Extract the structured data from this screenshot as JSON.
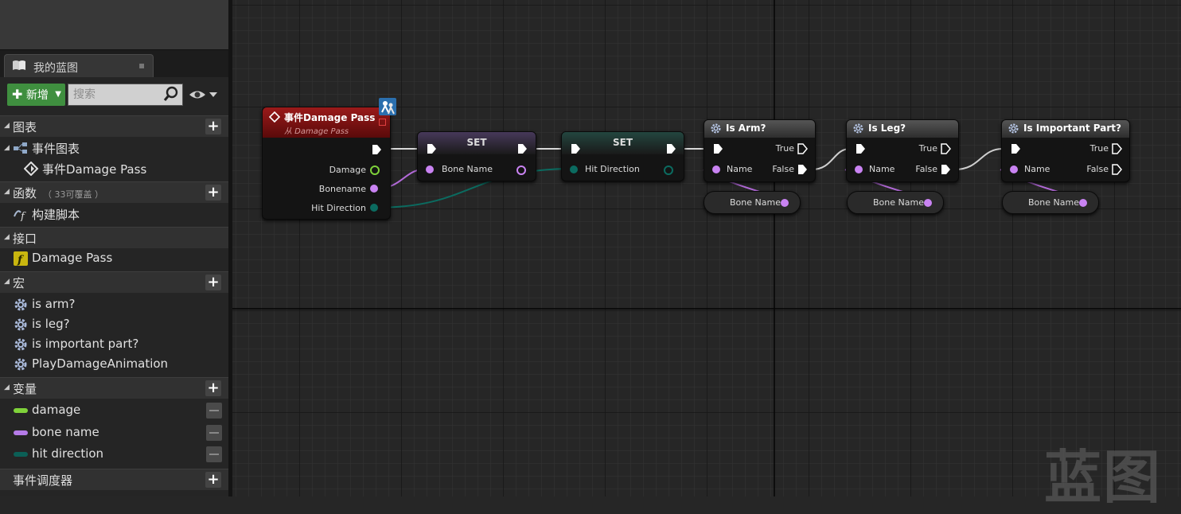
{
  "sidebar": {
    "tab": {
      "label": "我的蓝图"
    },
    "toolbar": {
      "new_label": "新增",
      "search_placeholder": "搜索"
    },
    "sections": {
      "graphs": {
        "label": "图表",
        "items": {
          "event_graph": "事件图表",
          "event_node": "事件Damage Pass"
        }
      },
      "functions": {
        "label": "函数",
        "count": "（ 33可覆盖 ）",
        "items": {
          "construction": "构建脚本"
        }
      },
      "interfaces": {
        "label": "接口",
        "items": {
          "damage_pass": "Damage Pass"
        }
      },
      "macros": {
        "label": "宏",
        "items": [
          "is arm?",
          "is leg?",
          "is important part?",
          "PlayDamageAnimation"
        ]
      },
      "variables": {
        "label": "变量",
        "items": [
          {
            "name": "damage",
            "color": "#7fd23a"
          },
          {
            "name": "bone name",
            "color": "#b57be8"
          },
          {
            "name": "hit direction",
            "color": "#0b5f56"
          }
        ]
      },
      "dispatchers": {
        "label": "事件调度器"
      }
    }
  },
  "graph": {
    "event_node": {
      "title": "事件Damage Pass",
      "subtitle": "从 Damage Pass",
      "pins": [
        "Damage",
        "Bonename",
        "Hit Direction"
      ]
    },
    "set1": {
      "title": "SET",
      "pin": "Bone Name"
    },
    "set2": {
      "title": "SET",
      "pin": "Hit Direction"
    },
    "macro_nodes": [
      {
        "title": "Is Arm?",
        "in_pin": "Name",
        "true_label": "True",
        "false_label": "False",
        "getter": "Bone Name"
      },
      {
        "title": "Is Leg?",
        "in_pin": "Name",
        "true_label": "True",
        "false_label": "False",
        "getter": "Bone Name"
      },
      {
        "title": "Is Important Part?",
        "in_pin": "Name",
        "true_label": "True",
        "false_label": "False",
        "getter": "Bone Name"
      }
    ],
    "watermark": "蓝图",
    "colors": {
      "exec": "#ffffff",
      "float": "#7fd23a",
      "name": "#c983f2",
      "vector": "#0b6b60",
      "event_header": "#8a1212",
      "macro_header": "#3c3c3c",
      "set_header_1": "#3b3047",
      "set_header_2": "#1f3b38"
    }
  }
}
